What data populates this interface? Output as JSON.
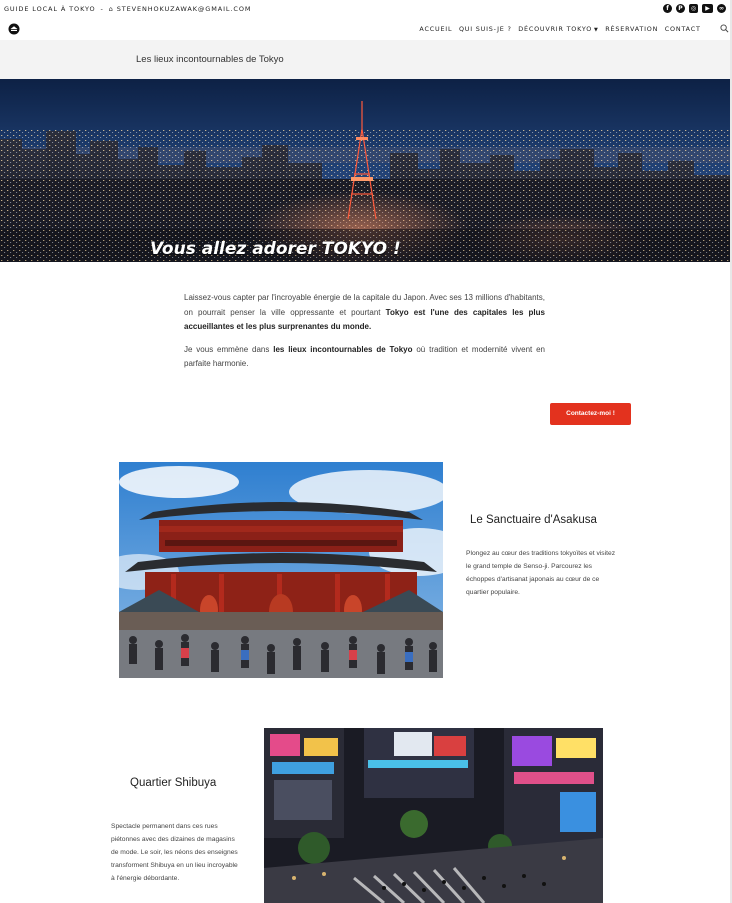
{
  "topbar": {
    "tagline": "GUIDE LOCAL À TOKYO",
    "separator": "-",
    "email": "STEVENHOKUZAWAK@GMAIL.COM",
    "socials": [
      {
        "name": "facebook-icon",
        "glyph": "f"
      },
      {
        "name": "pinterest-icon",
        "glyph": "P"
      },
      {
        "name": "instagram-icon",
        "glyph": "◎"
      },
      {
        "name": "youtube-icon",
        "glyph": "▶"
      },
      {
        "name": "tripadvisor-icon",
        "glyph": "∞"
      }
    ]
  },
  "nav": {
    "items": [
      {
        "label": "ACCUEIL"
      },
      {
        "label": "QUI SUIS-JE ?"
      },
      {
        "label": "DÉCOUVRIR TOKYO",
        "dropdown": true
      },
      {
        "label": "RÉSERVATION"
      },
      {
        "label": "CONTACT"
      }
    ]
  },
  "page": {
    "title": "Les lieux incontournables de Tokyo"
  },
  "hero": {
    "title": "Vous allez adorer TOKYO !"
  },
  "intro": {
    "p1_a": "Laissez-vous capter par l'incroyable énergie de la capitale du Japon. Avec ses 13 millions d'habitants, on pourrait penser la ville oppressante et pourtant ",
    "p1_bold": "Tokyo est l'une des capitales les plus accueillantes et les plus surprenantes du monde.",
    "p2_a": "Je vous emmène dans ",
    "p2_bold": "les lieux incontournables de Tokyo",
    "p2_b": " où tradition et modernité vivent en parfaite harmonie."
  },
  "cta": {
    "label": "Contactez-moi !"
  },
  "sections": {
    "asakusa": {
      "title": "Le Sanctuaire d'Asakusa",
      "text": "Plongez au cœur des traditions tokyoïtes et visitez le grand temple de Senso-ji. Parcourez les échoppes d'artisanat japonais au cœur de ce quartier populaire."
    },
    "shibuya": {
      "title": "Quartier Shibuya",
      "text": "Spectacle permanent dans ces rues piétonnes avec des dizaines de magasins de mode. Le soir, les néons des enseignes transforment Shibuya en un lieu incroyable à l'énergie débordante."
    }
  },
  "colors": {
    "accent": "#e3321e",
    "header_bg": "#f3f3f3",
    "text": "#333333"
  }
}
